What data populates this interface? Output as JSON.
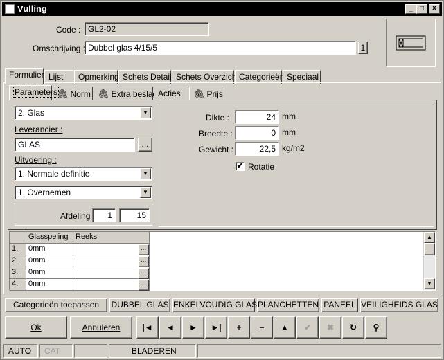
{
  "window": {
    "title": "Vulling",
    "controls": {
      "minimize": "_",
      "maximize": "□",
      "close": "X"
    }
  },
  "header": {
    "code_label": "Code :",
    "code_value": "GL2-02",
    "omschrijving_label": "Omschrijving :",
    "omschrijving_value": "Dubbel glas 4/15/5",
    "omschrijving_count": "1"
  },
  "main_tabs": [
    "Formulier",
    "Lijst",
    "Opmerking",
    "Schets Detail",
    "Schets Overzicht",
    "Categorieën",
    "Speciaal"
  ],
  "sub_tabs": [
    {
      "label": "Parameters",
      "clip": false
    },
    {
      "label": "Norm",
      "clip": true
    },
    {
      "label": "Extra beslag",
      "clip": true
    },
    {
      "label": "Acties",
      "clip": false
    },
    {
      "label": "Prijs",
      "clip": true
    }
  ],
  "left": {
    "type_select": "2.  Glas",
    "leverancier_label": "Leverancier :",
    "leverancier_value": "GLAS",
    "browse_label": "...",
    "uitvoering_label": "Uitvoering :",
    "uitvoering_select": "1.  Normale definitie",
    "overnemen_select": "1.  Overnemen",
    "afdeling_label": "Afdeling :",
    "afdeling_value1": "1",
    "afdeling_value2": "15"
  },
  "right": {
    "dikte_label": "Dikte :",
    "dikte_value": "24",
    "dikte_unit": "mm",
    "breedte_label": "Breedte :",
    "breedte_value": "0",
    "breedte_unit": "mm",
    "gewicht_label": "Gewicht :",
    "gewicht_value": "22,5",
    "gewicht_unit": "kg/m2",
    "rotatie_label": "Rotatie",
    "rotatie_checked": "✔"
  },
  "grid": {
    "headers": [
      "",
      "Glasspeling",
      "Reeks"
    ],
    "rows": [
      {
        "num": "1.",
        "glasspeling": "0mm",
        "reeks": ""
      },
      {
        "num": "2.",
        "glasspeling": "0mm",
        "reeks": ""
      },
      {
        "num": "3.",
        "glasspeling": "0mm",
        "reeks": ""
      },
      {
        "num": "4.",
        "glasspeling": "0mm",
        "reeks": ""
      }
    ],
    "cell_button": "..."
  },
  "category_buttons": [
    "Categorieën toepassen",
    "DUBBEL GLAS",
    "ENKELVOUDIG GLAS",
    "PLANCHETTEN",
    "PANEEL",
    "VEILIGHEIDS GLAS"
  ],
  "actions": {
    "ok": "Ok",
    "annuleren": "Annuleren"
  },
  "nav_buttons": [
    {
      "name": "first-record-icon",
      "glyph": "|◄",
      "enabled": true
    },
    {
      "name": "prev-record-icon",
      "glyph": "◄",
      "enabled": true
    },
    {
      "name": "next-record-icon",
      "glyph": "►",
      "enabled": true
    },
    {
      "name": "last-record-icon",
      "glyph": "►|",
      "enabled": true
    },
    {
      "name": "add-icon",
      "glyph": "+",
      "enabled": true
    },
    {
      "name": "delete-icon",
      "glyph": "−",
      "enabled": true
    },
    {
      "name": "edit-icon",
      "glyph": "▲",
      "enabled": true
    },
    {
      "name": "confirm-icon",
      "glyph": "✔",
      "enabled": false
    },
    {
      "name": "cancel-edit-icon",
      "glyph": "✖",
      "enabled": false
    },
    {
      "name": "refresh-icon",
      "glyph": "↻",
      "enabled": true
    },
    {
      "name": "search-binoculars-icon",
      "glyph": "⚲",
      "enabled": true
    }
  ],
  "status": {
    "s1": "AUTO",
    "s2": "CAT",
    "s3": "",
    "s4": "BLADEREN",
    "s5": ""
  }
}
